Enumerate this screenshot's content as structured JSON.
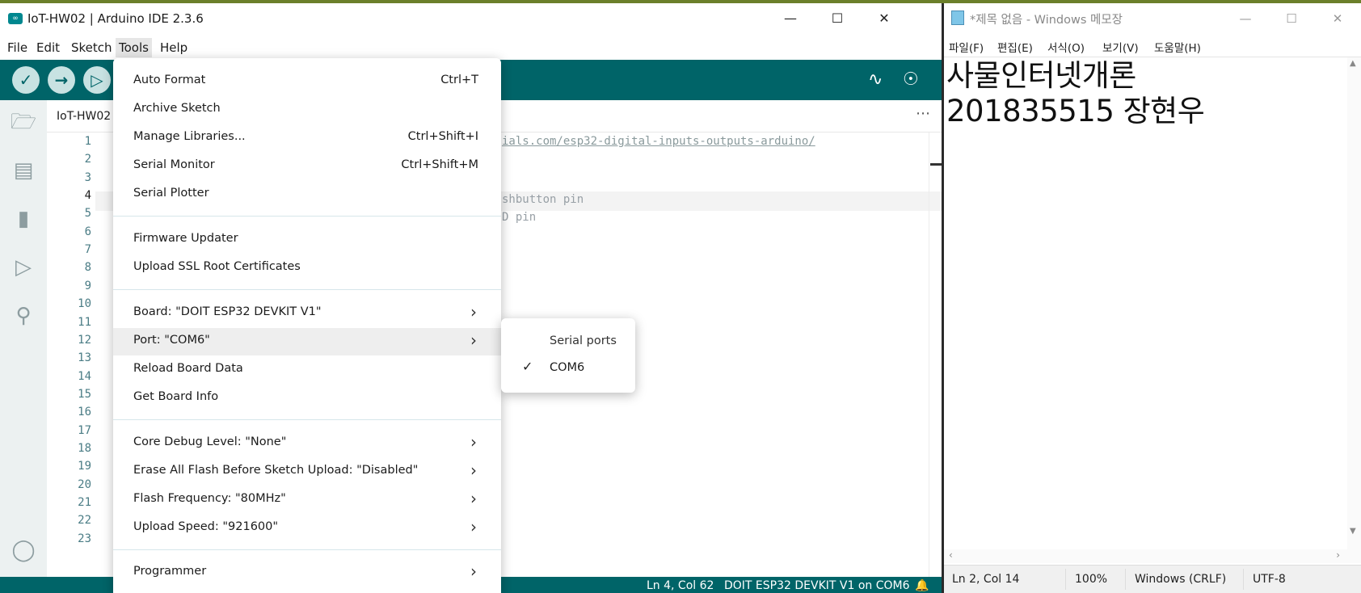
{
  "arduino": {
    "title": "IoT-HW02 | Arduino IDE 2.3.6",
    "app_icon": "∞",
    "menu": [
      "File",
      "Edit",
      "Sketch",
      "Tools",
      "Help"
    ],
    "tab_name": "IoT-HW02",
    "line_numbers": [
      "1",
      "2",
      "3",
      "4",
      "5",
      "6",
      "7",
      "8",
      "9",
      "10",
      "11",
      "12",
      "13",
      "14",
      "15",
      "16",
      "17",
      "18",
      "19",
      "20",
      "21",
      "22",
      "23"
    ],
    "code_fragments": {
      "line1": "ials.com/esp32-digital-inputs-outputs-arduino/",
      "line4": "shbutton pin",
      "line5": "D pin"
    },
    "status": {
      "position": "Ln 4, Col 62",
      "board": "DOIT ESP32 DEVKIT V1 on COM6"
    }
  },
  "tools_menu": {
    "items": [
      {
        "label": "Auto Format",
        "shortcut": "Ctrl+T"
      },
      {
        "label": "Archive Sketch",
        "shortcut": ""
      },
      {
        "label": "Manage Libraries...",
        "shortcut": "Ctrl+Shift+I"
      },
      {
        "label": "Serial Monitor",
        "shortcut": "Ctrl+Shift+M"
      },
      {
        "label": "Serial Plotter",
        "shortcut": ""
      },
      {
        "label": "Firmware Updater",
        "shortcut": ""
      },
      {
        "label": "Upload SSL Root Certificates",
        "shortcut": ""
      },
      {
        "label": "Board: \"DOIT ESP32 DEVKIT V1\"",
        "shortcut": ""
      },
      {
        "label": "Port: \"COM6\"",
        "shortcut": ""
      },
      {
        "label": "Reload Board Data",
        "shortcut": ""
      },
      {
        "label": "Get Board Info",
        "shortcut": ""
      },
      {
        "label": "Core Debug Level: \"None\"",
        "shortcut": ""
      },
      {
        "label": "Erase All Flash Before Sketch Upload: \"Disabled\"",
        "shortcut": ""
      },
      {
        "label": "Flash Frequency: \"80MHz\"",
        "shortcut": ""
      },
      {
        "label": "Upload Speed: \"921600\"",
        "shortcut": ""
      },
      {
        "label": "Programmer",
        "shortcut": ""
      }
    ]
  },
  "port_submenu": {
    "title": "Serial ports",
    "selected": "COM6"
  },
  "notepad": {
    "title": "*제목 없음 - Windows 메모장",
    "menu": [
      "파일(F)",
      "편집(E)",
      "서식(O)",
      "보기(V)",
      "도움말(H)"
    ],
    "lines": [
      "사물인터넷개론",
      "201835515 장현우"
    ],
    "status": {
      "position": "Ln 2, Col 14",
      "zoom": "100%",
      "line_ending": "Windows (CRLF)",
      "encoding": "UTF-8"
    }
  }
}
